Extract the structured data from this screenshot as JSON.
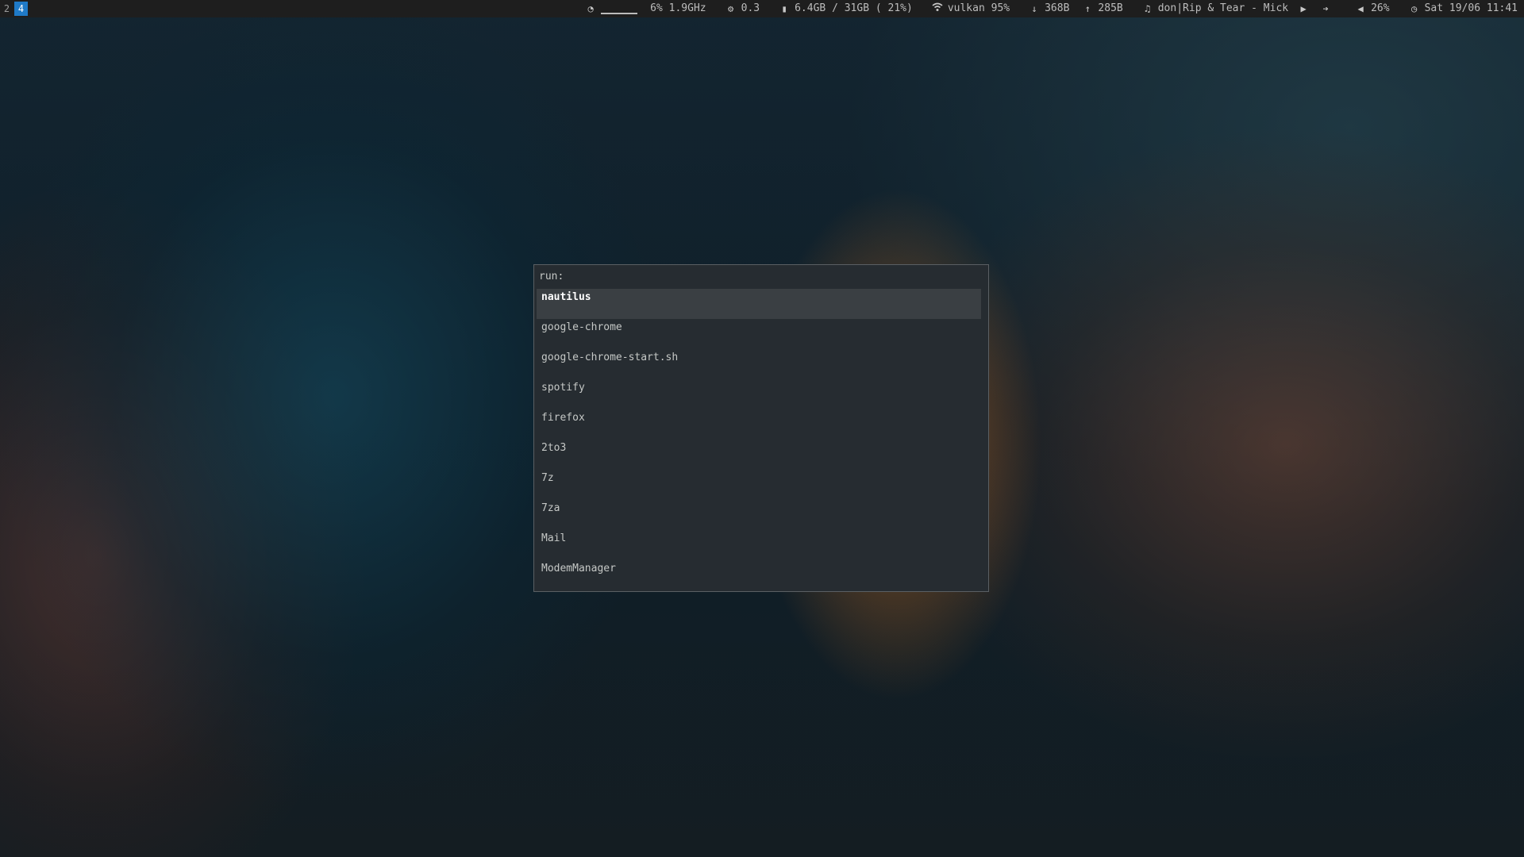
{
  "workspaces": [
    "2",
    "4"
  ],
  "active_workspace": "4",
  "status": {
    "cpu": "6% 1.9GHz",
    "load": "0.3",
    "memory": "6.4GB / 31GB ( 21%)",
    "wifi": "vulkan 95%",
    "net_down": "368B",
    "net_up": "285B",
    "music": "don|Rip & Tear - Mick",
    "volume": "26%",
    "clock": "Sat 19/06 11:41"
  },
  "icons": {
    "cpu": "dashboard-icon",
    "load": "gears-icon",
    "memory": "memory-icon",
    "wifi": "wifi-icon",
    "down": "arrow-down-icon",
    "up": "arrow-up-icon",
    "music": "music-note-icon",
    "play": "play-icon",
    "next": "next-arrow-icon",
    "volume": "speaker-icon",
    "clock": "clock-icon"
  },
  "launcher": {
    "prompt": "run:",
    "items": [
      "nautilus",
      "google-chrome",
      "google-chrome-start.sh",
      "spotify",
      "firefox",
      "2to3",
      "7z",
      "7za",
      "Mail",
      "ModemManager"
    ],
    "selected": "nautilus"
  },
  "colors": {
    "bar_bg": "#1e1e1e",
    "active_ws": "#1f7ac7",
    "launcher_bg": "#262c31",
    "launcher_selected": "#3a3f43"
  }
}
